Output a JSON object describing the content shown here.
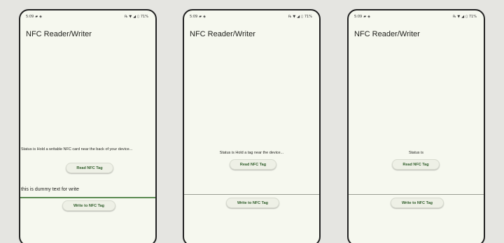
{
  "status_bar": {
    "time": "5:09",
    "battery": "71%"
  },
  "app": {
    "title": "NFC Reader/Writer"
  },
  "buttons": {
    "read": "Read NFC Tag",
    "write": "Write to NFC Tag"
  },
  "screens": [
    {
      "status": "Status is Hold a writable NFC card near the back of your device...",
      "write_text": "this is dummy text for write"
    },
    {
      "status": "Status is Hold a tag near the device..."
    },
    {
      "status": "Status is"
    }
  ]
}
